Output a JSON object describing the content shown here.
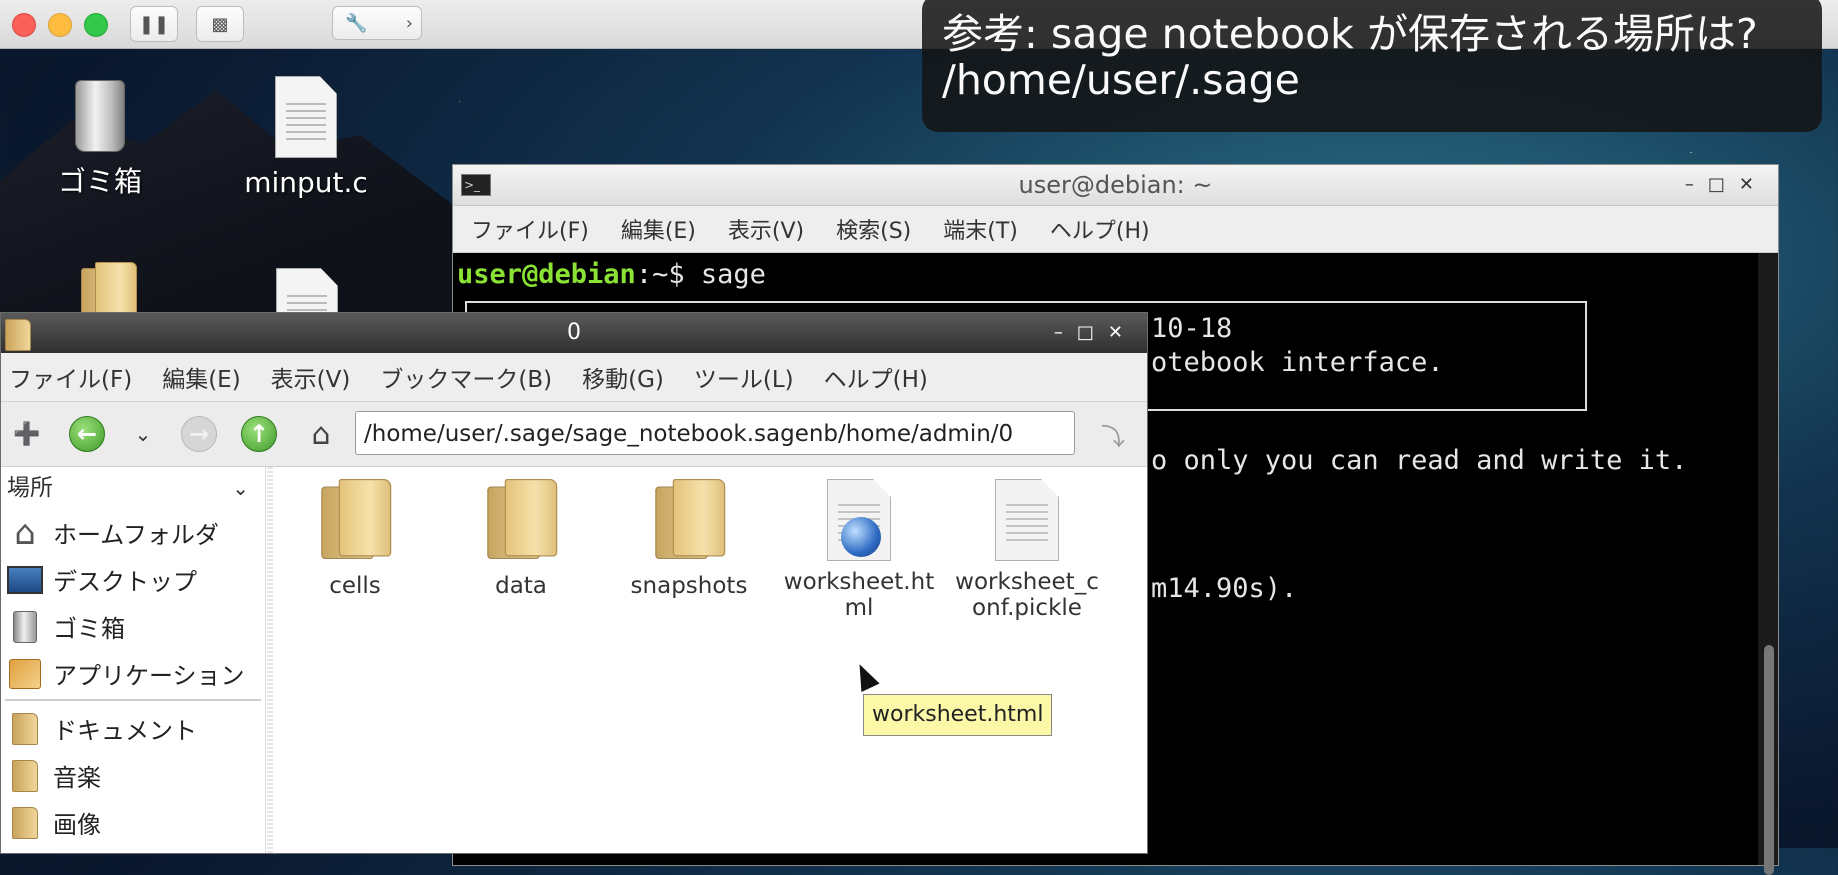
{
  "caption": {
    "line1": "参考: sage notebook が保存される場所は?",
    "line2": "/home/user/.sage"
  },
  "desktop": {
    "icons": [
      {
        "label": "ゴミ箱",
        "icon": "trash-icon"
      },
      {
        "label": "minput.c",
        "icon": "document-icon"
      }
    ]
  },
  "terminal": {
    "title": "user@debian: ~",
    "menu": [
      "ファイル(F)",
      "編集(E)",
      "表示(V)",
      "検索(S)",
      "端末(T)",
      "ヘルプ(H)"
    ],
    "prompt_user": "user@debian",
    "prompt_rest": ":~$ sage",
    "lines": [
      "10-18",
      "otebook interface.",
      "o only you can read and write it.",
      "m14.90s)."
    ]
  },
  "file_manager": {
    "title": "0",
    "menu": [
      "ファイル(F)",
      "編集(E)",
      "表示(V)",
      "ブックマーク(B)",
      "移動(G)",
      "ツール(L)",
      "ヘルプ(H)"
    ],
    "address": "/home/user/.sage/sage_notebook.sagenb/home/admin/0",
    "sidebar": {
      "header": "場所",
      "places": [
        {
          "label": "ホームフォルダ",
          "icon": "home-icon"
        },
        {
          "label": "デスクトップ",
          "icon": "desktop-icon"
        },
        {
          "label": "ゴミ箱",
          "icon": "trash-icon"
        },
        {
          "label": "アプリケーション",
          "icon": "applications-icon"
        }
      ],
      "bookmarks": [
        {
          "label": "ドキュメント",
          "icon": "folder-icon"
        },
        {
          "label": "音楽",
          "icon": "folder-icon"
        },
        {
          "label": "画像",
          "icon": "folder-icon"
        }
      ]
    },
    "items": [
      {
        "label": "cells",
        "type": "folder"
      },
      {
        "label": "data",
        "type": "folder"
      },
      {
        "label": "snapshots",
        "type": "folder"
      },
      {
        "label": "worksheet.html",
        "label_wrapped": "worksheet.ht\nml",
        "type": "html-file"
      },
      {
        "label": "worksheet_conf.pickle",
        "label_wrapped": "worksheet_c\nonf.pickle",
        "type": "file"
      }
    ],
    "tooltip": "worksheet.html"
  }
}
